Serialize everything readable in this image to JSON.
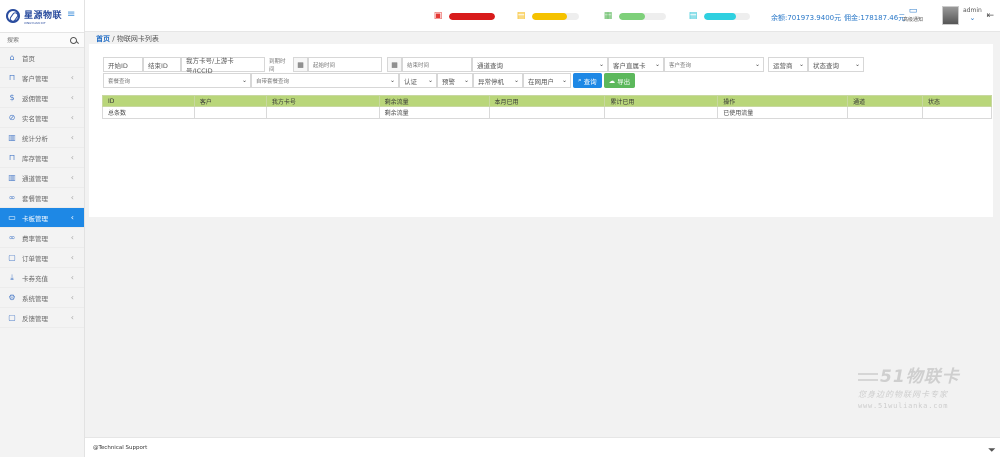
{
  "brand": {
    "title": "星源物联",
    "subtitle": "XINGYUAN IOT"
  },
  "sidebar": {
    "search_placeholder": "搜索",
    "items": [
      {
        "label": "首页",
        "icon": "home-icon",
        "glyph": "⌂",
        "chevron": false
      },
      {
        "label": "客户管理",
        "icon": "bookmark-icon",
        "glyph": "⊓",
        "chevron": true
      },
      {
        "label": "返佣管理",
        "icon": "dollar-icon",
        "glyph": "$",
        "chevron": true
      },
      {
        "label": "实名管理",
        "icon": "ban-icon",
        "glyph": "⊘",
        "chevron": true
      },
      {
        "label": "统计分析",
        "icon": "columns-icon",
        "glyph": "▥",
        "chevron": true
      },
      {
        "label": "库存管理",
        "icon": "bookmark-icon",
        "glyph": "⊓",
        "chevron": true
      },
      {
        "label": "通道管理",
        "icon": "columns-icon",
        "glyph": "▥",
        "chevron": true
      },
      {
        "label": "套餐管理",
        "icon": "link-icon",
        "glyph": "∞",
        "chevron": true
      },
      {
        "label": "卡板管理",
        "icon": "folder-icon",
        "glyph": "▭",
        "chevron": true
      },
      {
        "label": "费率管理",
        "icon": "link-icon",
        "glyph": "∞",
        "chevron": true
      },
      {
        "label": "订单管理",
        "icon": "comment-icon",
        "glyph": "▢",
        "chevron": true
      },
      {
        "label": "卡券充值",
        "icon": "download-icon",
        "glyph": "⤓",
        "chevron": true
      },
      {
        "label": "系统管理",
        "icon": "gear-icon",
        "glyph": "⚙",
        "chevron": true
      },
      {
        "label": "反馈管理",
        "icon": "comment-icon",
        "glyph": "▢",
        "chevron": true
      }
    ],
    "active_index": 8
  },
  "topbar": {
    "status": [
      {
        "icon": "cpu-icon",
        "glyph": "▣",
        "color": "#e53935",
        "level": 1.0,
        "fill": "#d81b1b"
      },
      {
        "icon": "file-icon",
        "glyph": "▤",
        "color": "#f5b400",
        "level": 0.75,
        "fill": "#f5c200"
      },
      {
        "icon": "server-icon",
        "glyph": "▦",
        "color": "#5cb85c",
        "level": 0.55,
        "fill": "#7ed07a"
      },
      {
        "icon": "drive-icon",
        "glyph": "▤",
        "color": "#29c3d6",
        "level": 0.7,
        "fill": "#2fd0e0"
      }
    ],
    "balance": "余额:701973.9400元",
    "commission": "佣金:178187.46元",
    "notify_label": "高级通知",
    "user": "admin"
  },
  "breadcrumb": {
    "home": "首页",
    "sep": "/",
    "current": "物联网卡列表"
  },
  "filters": {
    "row1": {
      "start_id": "开始ID",
      "end_id": "结束ID",
      "card_no": "我方卡号/上游卡号/ICCID",
      "expire_time": "到期时间",
      "start_time": "起始时间",
      "end_time": "结束时间",
      "channel_query": "通道查询",
      "customer_direct": "客户直属卡",
      "customer_query": "客户查询",
      "operator": "运营商",
      "status_query": "状态查询"
    },
    "row2": {
      "package_query": "套餐查询",
      "own_package_query": "自带套餐查询",
      "certify": "认证",
      "warning": "预警",
      "abnormal_stop": "异常停机",
      "online_user": "在网用户",
      "query_btn": "查询",
      "export_btn": "导出"
    }
  },
  "table": {
    "headers": [
      "ID",
      "客户",
      "我方卡号",
      "剩余流量",
      "本月已用",
      "累计已用",
      "操作",
      "通道",
      "状态"
    ],
    "rows": [
      [
        "总条数",
        "",
        "",
        "剩余流量",
        "",
        "",
        "已使用流量",
        "",
        ""
      ]
    ]
  },
  "footer": {
    "text": "@Technical Support"
  },
  "watermark": {
    "brand": "51物联卡",
    "slogan": "您身边的物联网卡专家",
    "url": "www.51wulianka.com"
  }
}
